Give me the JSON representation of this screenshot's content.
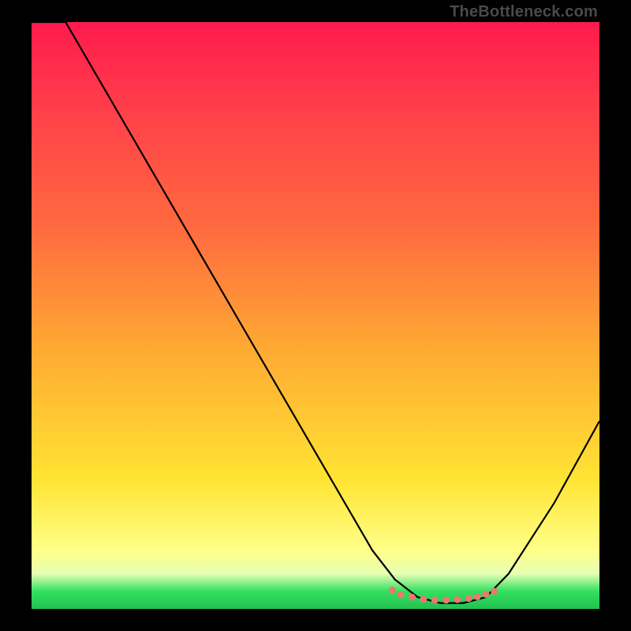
{
  "attribution": "TheBottleneck.com",
  "chart_data": {
    "type": "line",
    "title": "",
    "xlabel": "",
    "ylabel": "",
    "xlim": [
      0,
      100
    ],
    "ylim": [
      0,
      100
    ],
    "grid": false,
    "series": [
      {
        "name": "bottleneck-curve",
        "x": [
          0,
          6,
          12,
          18,
          24,
          30,
          36,
          42,
          48,
          54,
          60,
          64,
          68,
          72,
          76,
          80,
          84,
          88,
          92,
          96,
          100
        ],
        "values": [
          100,
          100,
          90,
          80,
          70,
          60,
          50,
          40,
          30,
          20,
          10,
          5,
          2,
          1,
          1,
          2,
          6,
          12,
          18,
          25,
          32
        ]
      }
    ],
    "markers": {
      "name": "optimal-range-dots",
      "x": [
        63.5,
        65,
        67,
        69,
        71,
        73,
        75,
        77,
        78.5,
        80,
        81.5
      ],
      "values": [
        3.2,
        2.4,
        2.0,
        1.7,
        1.5,
        1.5,
        1.6,
        1.8,
        2.1,
        2.5,
        3.0
      ]
    },
    "background_gradient": {
      "top": "#ff1a4d",
      "upper_mid": "#ff6a3f",
      "mid": "#ffe433",
      "lower_mid": "#ffff88",
      "bottom": "#22c24f"
    },
    "line_color": "#000000",
    "marker_color": "#e87a6f",
    "marker_size": 4.5
  }
}
